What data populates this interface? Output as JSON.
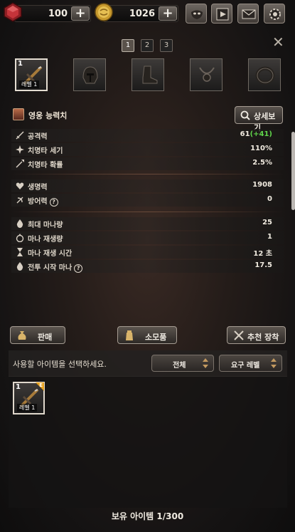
{
  "currency": {
    "gems": "100",
    "gold": "1026"
  },
  "top_menu": [
    "mask-icon",
    "video-icon",
    "mail-icon",
    "settings-icon"
  ],
  "page_tabs": [
    "1",
    "2",
    "3"
  ],
  "active_page_tab": "1",
  "equipment_slots": [
    {
      "icon": "crossbow-icon",
      "count": "1",
      "level_label": "레벨 1",
      "selected": true
    },
    {
      "icon": "helmet-icon"
    },
    {
      "icon": "boots-icon"
    },
    {
      "icon": "necklace-icon"
    },
    {
      "icon": "ring-icon"
    }
  ],
  "hero": {
    "title": "영웅 능력치",
    "detail_button": "상세보기"
  },
  "stats": {
    "attack": {
      "label": "공격력",
      "value": "61",
      "bonus": "(+41)"
    },
    "crit_power": {
      "label": "치명타 세기",
      "value": "110%"
    },
    "crit_chance": {
      "label": "치명타 확률",
      "value": "2.5%"
    },
    "hp": {
      "label": "생명력",
      "value": "1908"
    },
    "defense": {
      "label": "방어력",
      "value": "0",
      "help": "?"
    },
    "max_mana": {
      "label": "최대 마나량",
      "value": "25"
    },
    "mana_regen": {
      "label": "마나 재생량",
      "value": "1"
    },
    "mana_regen_time": {
      "label": "마나 재생 시간",
      "value": "12 초"
    },
    "start_mana": {
      "label": "전투 시작 마나",
      "value": "17.5",
      "help": "?"
    }
  },
  "actions": {
    "sell": "판매",
    "consumables": "소모품",
    "recommend": "추천 장착"
  },
  "inventory": {
    "hint": "사용할 아이템을 선택하세요.",
    "filter_all": "전체",
    "sort_level": "요구 레벨",
    "items": [
      {
        "icon": "crossbow-icon",
        "count": "1",
        "level_label": "레벨 1",
        "corner": "E"
      }
    ],
    "owned_label": "보유 아이템",
    "owned_count": "1/300"
  },
  "colors": {
    "bonus_green": "#5fd34a",
    "rarity_orange": "#e8a21e"
  }
}
